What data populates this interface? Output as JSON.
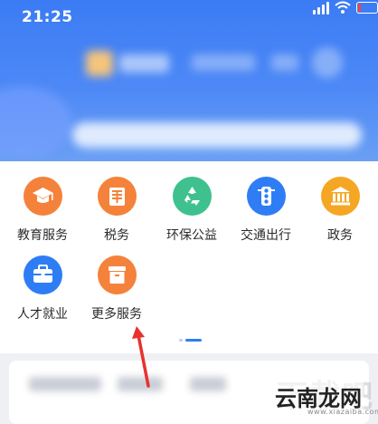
{
  "status_bar": {
    "time": "21:25"
  },
  "services": [
    {
      "label": "教育服务",
      "icon": "graduation-cap-icon",
      "color": "#f4823b"
    },
    {
      "label": "税务",
      "icon": "tax-seal-icon",
      "color": "#f4823b"
    },
    {
      "label": "环保公益",
      "icon": "recycle-icon",
      "color": "#3fc18f"
    },
    {
      "label": "交通出行",
      "icon": "traffic-light-icon",
      "color": "#2f7df4"
    },
    {
      "label": "政务",
      "icon": "government-building-icon",
      "color": "#f5a623"
    },
    {
      "label": "人才就业",
      "icon": "briefcase-icon",
      "color": "#2f7df4"
    },
    {
      "label": "更多服务",
      "icon": "box-icon",
      "color": "#f4823b"
    }
  ],
  "page_indicator": {
    "pages": 2,
    "current": 1
  },
  "watermark": {
    "text": "云南龙网",
    "url": "www.xiazaiba.com"
  },
  "colors": {
    "header_blue": "#3b7bf4",
    "annotation_red": "#e8322d"
  }
}
